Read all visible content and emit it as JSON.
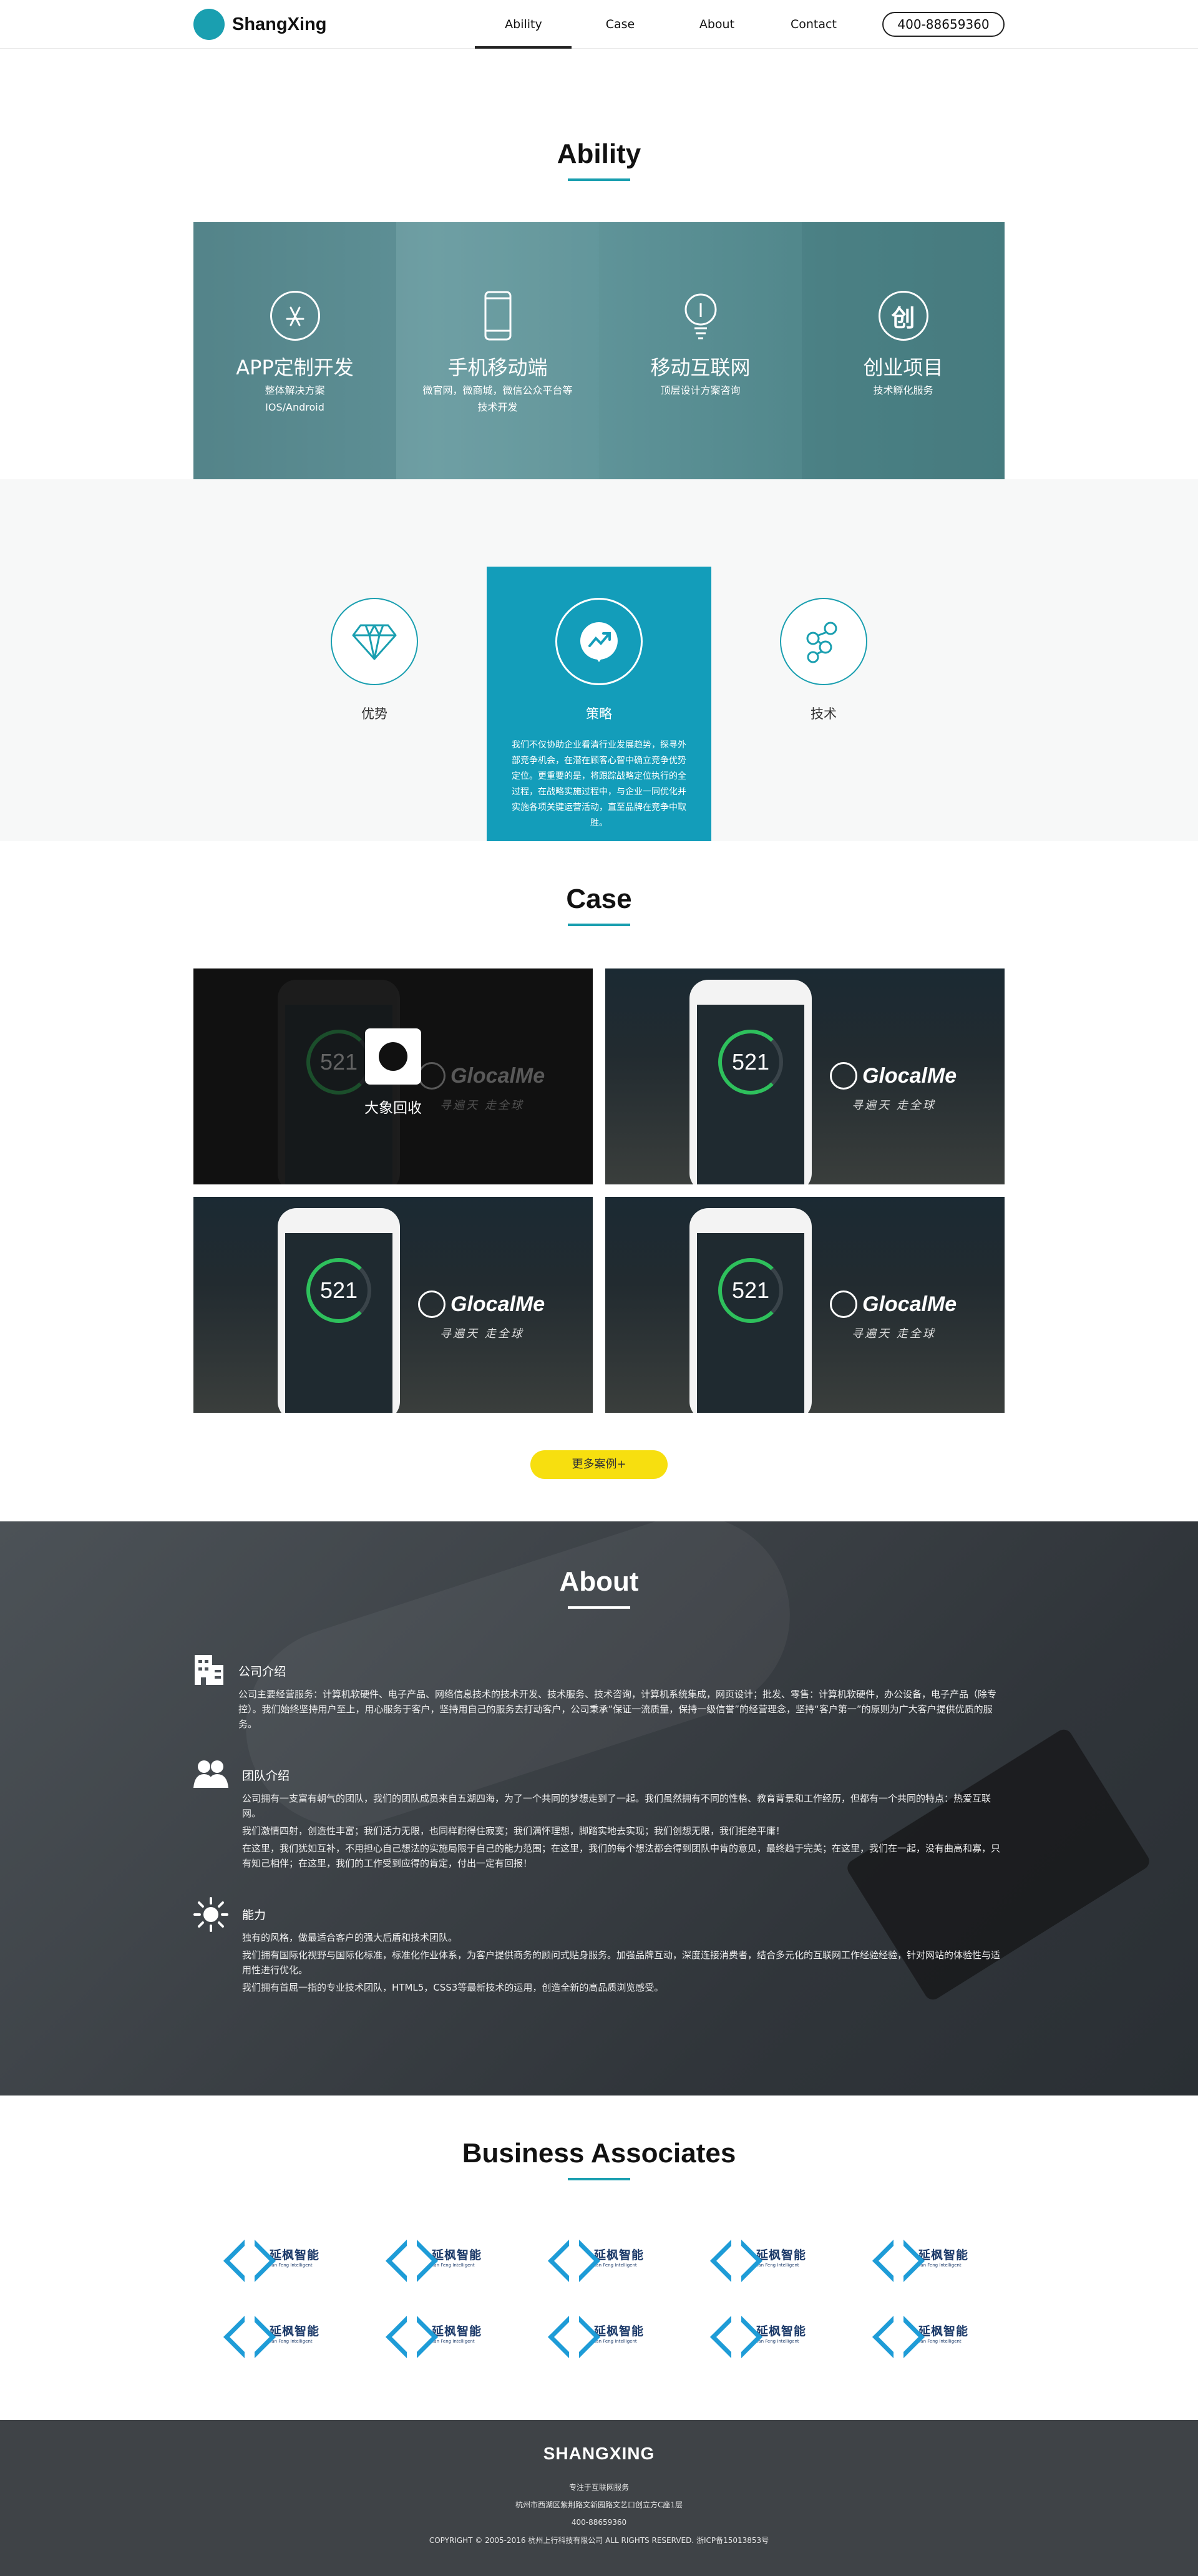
{
  "nav": {
    "brand": "ShangXing",
    "items": [
      "Ability",
      "Case",
      "About",
      "Contact"
    ],
    "phone": "400-88659360"
  },
  "ability": {
    "title": "Ability",
    "items": [
      {
        "icon": "app-store-icon",
        "title": "APP定制开发",
        "desc1": "整体解决方案",
        "desc2": "IOS/Android"
      },
      {
        "icon": "mobile-phone-icon",
        "title": "手机移动端",
        "desc1": "微官网，微商城，微信公众平台等",
        "desc2": "技术开发"
      },
      {
        "icon": "lightbulb-icon",
        "title": "移动互联网",
        "desc1": "顶层设计方案咨询",
        "desc2": ""
      },
      {
        "icon": "startup-icon",
        "title": "创业项目",
        "desc1": "技术孵化服务",
        "desc2": ""
      }
    ]
  },
  "features": {
    "items": [
      {
        "icon": "diamond-icon",
        "title": "优势",
        "text": ""
      },
      {
        "icon": "strategy-icon",
        "title": "策略",
        "text": "我们不仅协助企业看清行业发展趋势，探寻外部竞争机会，在潜在顾客心智中确立竞争优势定位。更重要的是，将跟踪战略定位执行的全过程，在战略实施过程中，与企业一同优化并实施各项关键运营活动，直至品牌在竞争中取胜。"
      },
      {
        "icon": "tech-molecule-icon",
        "title": "技术",
        "text": ""
      }
    ]
  },
  "case": {
    "title": "Case",
    "overlay_title": "大象回收",
    "brand": "GlocalMe",
    "brand_sub": "寻遍天 走全球",
    "app_name": "GlocalMe",
    "ring_value": "521",
    "more": "更多案例+"
  },
  "about": {
    "title": "About",
    "blocks": [
      {
        "icon": "building-icon",
        "title": "公司介绍",
        "paras": [
          "公司主要经营服务：计算机软硬件、电子产品、网络信息技术的技术开发、技术服务、技术咨询，计算机系统集成，网页设计；批发、零售：计算机软硬件，办公设备，电子产品（除专控）。我们始终坚持用户至上，用心服务于客户，坚持用自己的服务去打动客户，公司秉承“保证一流质量，保持一级信誉”的经营理念，坚持“客户第一”的原则为广大客户提供优质的服务。"
        ]
      },
      {
        "icon": "team-icon",
        "title": "团队介绍",
        "paras": [
          "公司拥有一支富有朝气的团队，我们的团队成员来自五湖四海，为了一个共同的梦想走到了一起。我们虽然拥有不同的性格、教育背景和工作经历，但都有一个共同的特点：热爱互联网。",
          "我们激情四射，创造性丰富；我们活力无限，也同样耐得住寂寞；我们满怀理想，脚踏实地去实现；我们创想无限，我们拒绝平庸！",
          "在这里，我们犹如互补，不用担心自己想法的实施局限于自己的能力范围；在这里，我们的每个想法都会得到团队中肯的意见，最终趋于完美；在这里，我们在一起，没有曲高和寡，只有知己相伴；在这里，我们的工作受到应得的肯定，付出一定有回报！"
        ]
      },
      {
        "icon": "sun-icon",
        "title": "能力",
        "paras": [
          "独有的风格，做最适合客户的强大后盾和技术团队。",
          "我们拥有国际化视野与国际化标准，标准化作业体系，为客户提供商务的顾问式贴身服务。加强品牌互动，深度连接消费者，结合多元化的互联网工作经验经验，针对网站的体验性与适用性进行优化。",
          "我们拥有首屈一指的专业技术团队，HTML5，CSS3等最新技术的运用，创造全新的高品质浏览感受。"
        ]
      }
    ]
  },
  "partners": {
    "title": "Business Associates",
    "logo_cn": "延枫智能",
    "logo_en": "Yan Feng Intelligent",
    "count": 10
  },
  "footer": {
    "brand": "SHANGXING",
    "line1": "专注于互联网服务",
    "line2": "杭州市西湖区紫荆路文新园路文艺口创立方C座1层",
    "line3": "400-88659360",
    "copyright": "COPYRIGHT © 2005-2016 杭州上行科技有限公司 ALL RIGHTS RESERVED. 浙ICP备15013853号"
  },
  "colors": {
    "accent": "#1a9fb0",
    "feature_active": "#139dba",
    "button": "#f7df0f",
    "footer": "#3f4347"
  }
}
